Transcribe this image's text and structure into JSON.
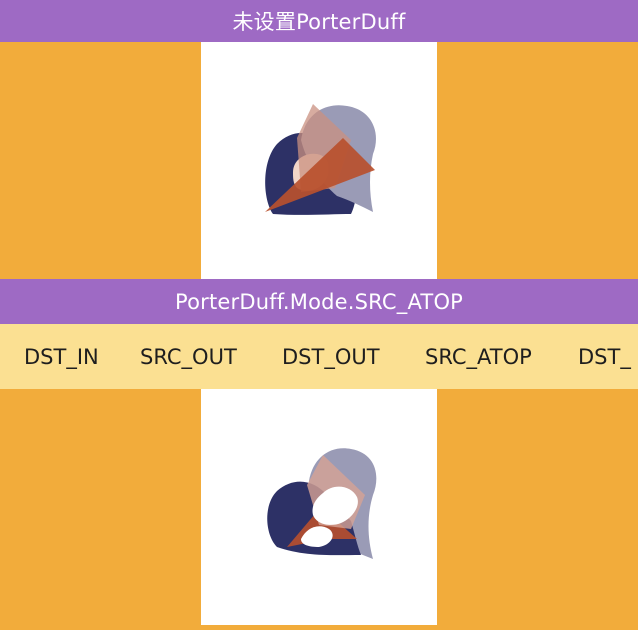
{
  "header": {
    "title": "未设置PorterDuff"
  },
  "mode_bar": {
    "title": "PorterDuff.Mode.SRC_ATOP"
  },
  "mode_list": {
    "items": [
      "DST_IN",
      "SRC_OUT",
      "DST_OUT",
      "SRC_ATOP",
      "DST_"
    ],
    "selected": "SRC_ATOP"
  },
  "colors": {
    "title_bar": "#9e6ac4",
    "background": "#f2ac3b",
    "mode_strip": "#fbe092",
    "panel": "#ffffff",
    "dst_shape": "#2d3166",
    "src_triangle": "#b8502e"
  }
}
